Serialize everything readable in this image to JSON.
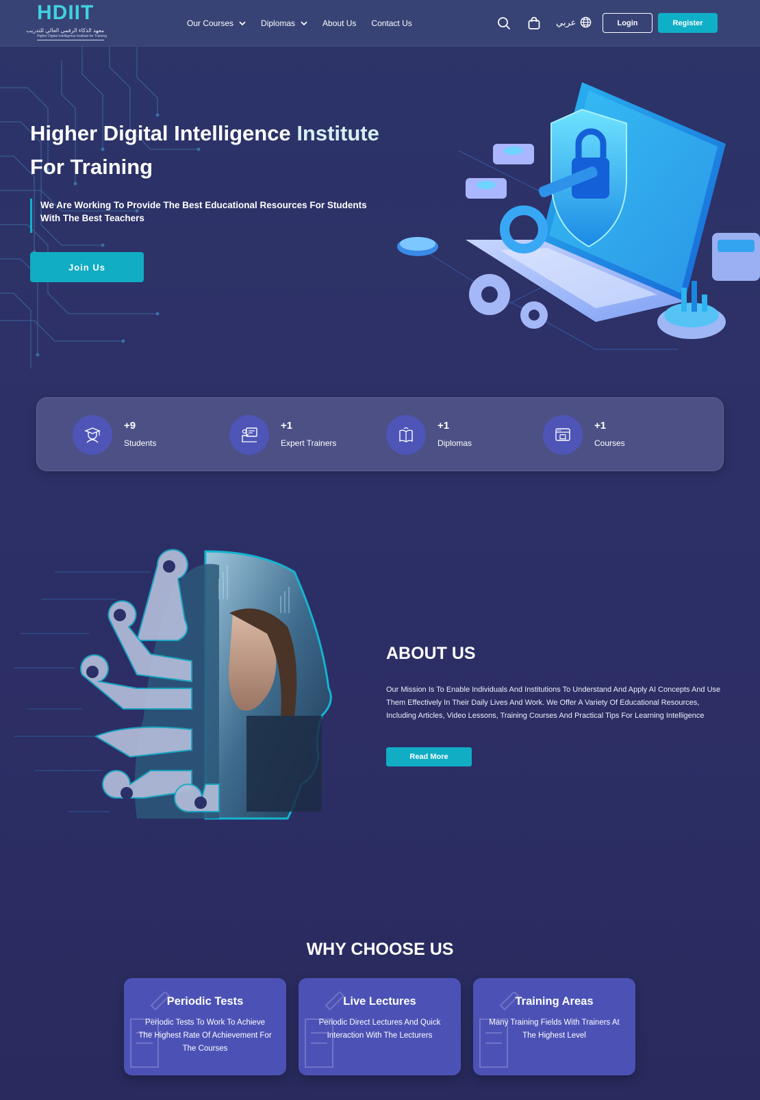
{
  "header": {
    "logo": {
      "mark": "HDIIT",
      "arabic": "معهد الذكاء الرقمي العالي للتدريب",
      "english": "Higher Digital Intelligence Institute for Training"
    },
    "nav": [
      {
        "label": "Our Courses",
        "has_dropdown": true
      },
      {
        "label": "Diplomas",
        "has_dropdown": true
      },
      {
        "label": "About Us",
        "has_dropdown": false
      },
      {
        "label": "Contact Us",
        "has_dropdown": false
      }
    ],
    "icons": [
      "search-icon",
      "shopping-bag-icon",
      "globe-icon"
    ],
    "language_label": "عربي",
    "login_label": "Login",
    "register_label": "Register"
  },
  "hero": {
    "title_line1_a": "Higher Digital Intelligence",
    "title_line1_b": "Institute",
    "title_line2": "For Training",
    "subtitle": "We Are Working To Provide The Best Educational Resources For Students With The Best Teachers",
    "cta_label": "Join Us"
  },
  "stats": [
    {
      "value": "+9",
      "label": "Students",
      "icon": "graduate-icon"
    },
    {
      "value": "+1",
      "label": "Expert Trainers",
      "icon": "trainer-icon"
    },
    {
      "value": "+1",
      "label": "Diplomas",
      "icon": "book-icon"
    },
    {
      "value": "+1",
      "label": "Courses",
      "icon": "course-window-icon"
    }
  ],
  "about": {
    "title": "ABOUT US",
    "text": "Our Mission Is To Enable Individuals And Institutions To Understand And Apply AI Concepts And Use Them Effectively In Their Daily Lives And Work. We Offer A Variety Of Educational Resources, Including Articles, Video Lessons, Training Courses And Practical Tips For Learning Intelligence",
    "button_label": "Read More"
  },
  "why": {
    "title": "WHY CHOOSE US",
    "cards": [
      {
        "title": "Periodic Tests",
        "text": "Periodic Tests To Work To Achieve The Highest Rate Of Achievement For The Courses"
      },
      {
        "title": "Live Lectures",
        "text": "Periodic Direct Lectures And Quick Interaction With The Lecturers"
      },
      {
        "title": "Training Areas",
        "text": "Many Training Fields With Trainers At The Highest Level"
      }
    ]
  },
  "colors": {
    "accent": "#11adc4",
    "card": "#4c52b5",
    "background": "#2c3068",
    "stat_circle": "#4e55b7"
  }
}
